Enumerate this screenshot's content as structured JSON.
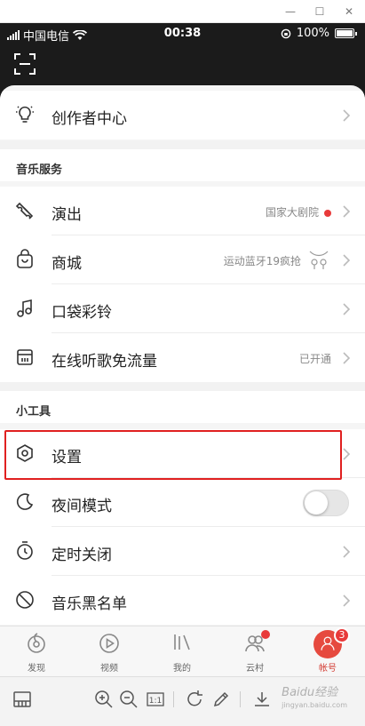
{
  "status_bar": {
    "carrier": "中国电信",
    "time": "00:38",
    "battery": "100%"
  },
  "creator": {
    "label": "创作者中心"
  },
  "music_services": {
    "header": "音乐服务",
    "items": [
      {
        "label": "演出",
        "sub": "国家大剧院",
        "icon": "ticket-icon"
      },
      {
        "label": "商城",
        "sub": "运动蓝牙19疯抢",
        "icon": "shopping-bag-icon"
      },
      {
        "label": "口袋彩铃",
        "sub": "",
        "icon": "music-note-icon"
      },
      {
        "label": "在线听歌免流量",
        "sub": "已开通",
        "icon": "sim-card-icon"
      }
    ]
  },
  "tools": {
    "header": "小工具",
    "items": [
      {
        "label": "设置",
        "icon": "settings-hexagon-icon"
      },
      {
        "label": "夜间模式",
        "icon": "moon-icon"
      },
      {
        "label": "定时关闭",
        "icon": "timer-icon"
      },
      {
        "label": "音乐黑名单",
        "icon": "block-icon"
      }
    ]
  },
  "tabs": [
    {
      "label": "发现",
      "icon": "discover-icon"
    },
    {
      "label": "视频",
      "icon": "video-icon"
    },
    {
      "label": "我的",
      "icon": "music-icon"
    },
    {
      "label": "云村",
      "icon": "community-icon"
    },
    {
      "label": "帐号",
      "icon": "account-icon",
      "badge": "3"
    }
  ],
  "colors": {
    "accent": "#e64a3f",
    "highlight_box": "#e02020",
    "badge": "#e83a3a"
  },
  "night_mode_on": false,
  "watermark": {
    "text": "Baidu经验",
    "sub": "jingyan.baidu.com"
  }
}
